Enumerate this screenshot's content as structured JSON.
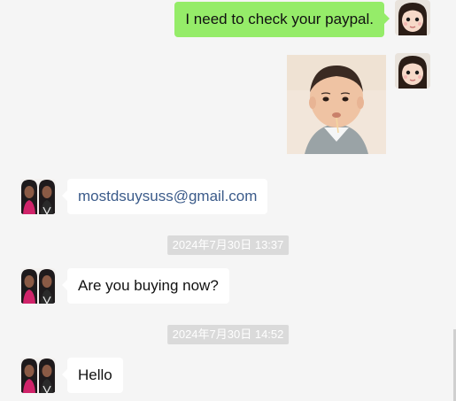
{
  "messages": {
    "self_text": "I need to check your paypal.",
    "email_text": "mostdsuysuss@gmail.com",
    "timestamp_1": "2024年7月30日 13:37",
    "buying_text": "Are you buying now?",
    "timestamp_2": "2024年7月30日 14:52",
    "hello_text": "Hello"
  },
  "colors": {
    "self_bubble": "#95ec69",
    "other_bubble": "#ffffff",
    "background": "#f5f5f5",
    "timestamp_bg": "#dadada",
    "link_text": "#3b5b8a"
  },
  "icons": {
    "self_avatar": "girl-avatar-icon",
    "other_avatar": "contact-avatar-icon",
    "image": "child-photo-image"
  }
}
